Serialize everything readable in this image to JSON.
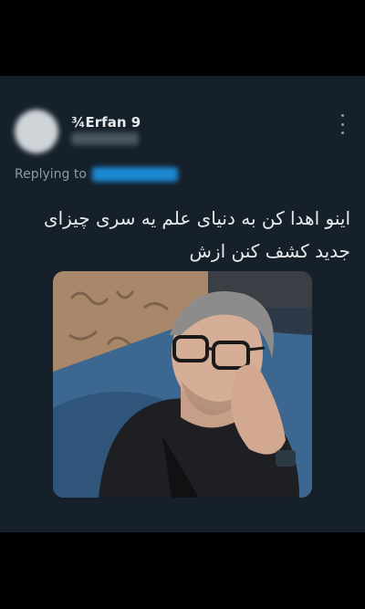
{
  "tweet": {
    "display_name": "¾Erfan 9",
    "reply_label": "Replying to",
    "text": "اینو اهدا کن به دنیای علم یه سری چیزای جدید کشف کنن ازش"
  },
  "icons": {
    "more": "more-vertical-icon"
  },
  "colors": {
    "card_background": "#15202b",
    "text_primary": "#e7e9ea",
    "text_secondary": "#8b98a5",
    "link": "#1d9bf0"
  }
}
